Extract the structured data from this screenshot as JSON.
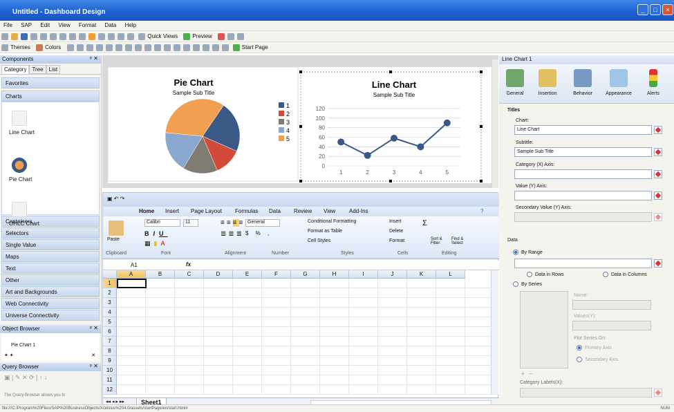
{
  "window": {
    "title": "Untitled - Dashboard Design"
  },
  "menu": [
    "File",
    "SAP",
    "Edit",
    "View",
    "Format",
    "Data",
    "Help"
  ],
  "toolbar1": {
    "quick_views": "Quick Views",
    "preview": "Preview"
  },
  "toolbar2": {
    "themes": "Themes",
    "colors": "Colors",
    "start_page": "Start Page"
  },
  "components": {
    "title": "Components",
    "tabs": [
      "Category",
      "Tree",
      "List"
    ],
    "categories_top": [
      "Favorites",
      "Charts"
    ],
    "chart_items": [
      "Line Chart",
      "Pie Chart",
      "OHLC Chart"
    ],
    "categories": [
      "Containers",
      "Selectors",
      "Single Value",
      "Maps",
      "Text",
      "Other",
      "Art and Backgrounds",
      "Web Connectivity",
      "Universe Connectivity"
    ]
  },
  "object_browser": {
    "title": "Object Browser",
    "item": "Pie Chart 1"
  },
  "query_browser": {
    "title": "Query Browser",
    "hint": "The Query Browser allows you to"
  },
  "pie_chart": {
    "title": "Pie Chart",
    "subtitle": "Sample Sub Title",
    "legend": [
      "1",
      "2",
      "3",
      "4",
      "5"
    ]
  },
  "line_chart": {
    "title": "Line Chart",
    "subtitle": "Sample Sub Title",
    "y_ticks": [
      "0",
      "20",
      "40",
      "60",
      "80",
      "100",
      "120"
    ],
    "x_ticks": [
      "1",
      "2",
      "3",
      "4",
      "5"
    ]
  },
  "chart_data": [
    {
      "type": "pie",
      "title": "Pie Chart",
      "subtitle": "Sample Sub Title",
      "categories": [
        "1",
        "2",
        "3",
        "4",
        "5"
      ],
      "values": [
        22,
        12,
        15,
        18,
        33
      ],
      "colors": [
        "#3a5a85",
        "#d24a3a",
        "#7f7a72",
        "#8aa8cf",
        "#f0a050"
      ]
    },
    {
      "type": "line",
      "title": "Line Chart",
      "subtitle": "Sample Sub Title",
      "x": [
        "1",
        "2",
        "3",
        "4",
        "5"
      ],
      "values": [
        50,
        22,
        58,
        40,
        90
      ],
      "ylim": [
        0,
        120
      ]
    }
  ],
  "excel": {
    "tabs": [
      "Home",
      "Insert",
      "Page Layout",
      "Formulas",
      "Data",
      "Review",
      "View",
      "Add-Ins"
    ],
    "font_name": "Calibri",
    "font_size": "11",
    "number_format": "General",
    "buttons": [
      "Paste",
      "Conditional Formatting",
      "Format as Table",
      "Cell Styles",
      "Insert",
      "Delete",
      "Format",
      "Sort & Filter",
      "Find & Select"
    ],
    "groups": [
      "Clipboard",
      "Font",
      "Alignment",
      "Number",
      "Styles",
      "Cells",
      "Editing"
    ],
    "name_box": "A1",
    "fx": "fx",
    "columns": [
      "A",
      "B",
      "C",
      "D",
      "E",
      "F",
      "G",
      "H",
      "I",
      "J",
      "K",
      "L"
    ],
    "rows": [
      "1",
      "2",
      "3",
      "4",
      "5",
      "6",
      "7",
      "8",
      "9",
      "10",
      "11",
      "12"
    ],
    "sheet_tab": "Sheet1"
  },
  "properties": {
    "title": "Line Chart 1",
    "tabs": [
      "General",
      "Insertion",
      "Behavior",
      "Appearance",
      "Alerts"
    ],
    "titles_header": "Titles",
    "chart_label": "Chart:",
    "chart_value": "Line Chart",
    "subtitle_label": "Subtitle:",
    "subtitle_value": "Sample Sub Title",
    "category_label": "Category (X) Axis:",
    "value_label": "Value (Y) Axis:",
    "secondary_label": "Secondary Value (Y) Axis:",
    "data_header": "Data",
    "by_range": "By Range",
    "by_series": "By Series",
    "data_in_rows": "Data in Rows",
    "data_in_columns": "Data in Columns",
    "name_label": "Name:",
    "values_label": "Values(Y):",
    "plot_series_on": "Plot Series On:",
    "primary_axis": "Primary Axis",
    "secondary_axis": "Secondary Axis",
    "category_labels": "Category Labels(X):"
  },
  "status": {
    "path": "file:///C:/Program%20Files/SAP%20BusinessObjects/Xcelsius%204.0/assets/startPage/en/start.html#",
    "mode": "NUM"
  }
}
